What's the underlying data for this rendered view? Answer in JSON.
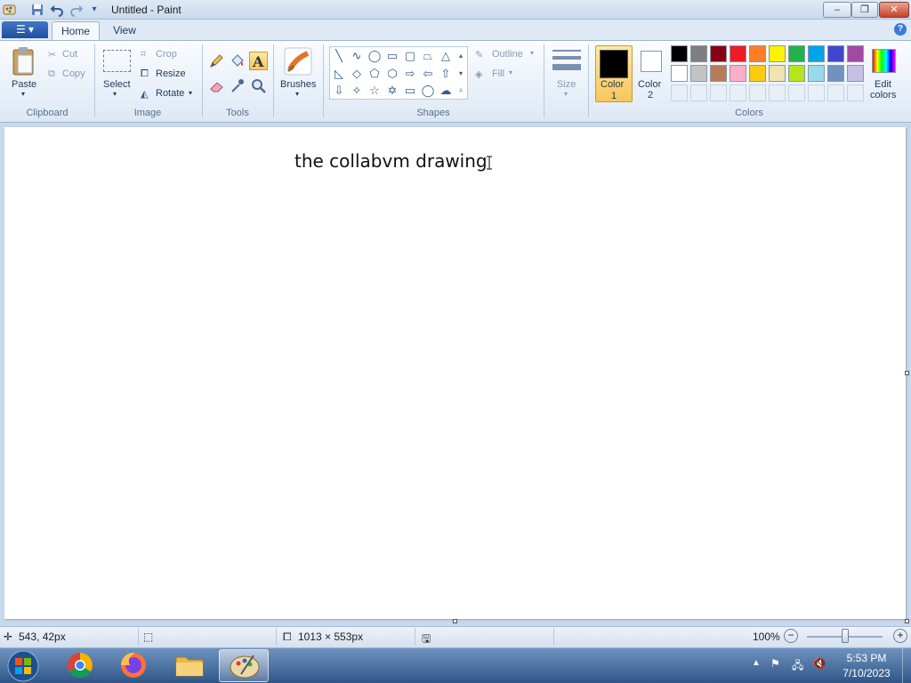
{
  "window": {
    "title": "Untitled - Paint",
    "minimize_label": "–",
    "restore_label": "❐",
    "close_label": "✕"
  },
  "quick_access": {
    "save_icon": "save-icon",
    "undo_icon": "undo-icon",
    "redo_icon": "redo-icon",
    "customize_icon": "dropdown-icon"
  },
  "tabs": [
    {
      "label": "Home",
      "active": true
    },
    {
      "label": "View",
      "active": false
    }
  ],
  "ribbon": {
    "clipboard": {
      "paste": "Paste",
      "cut": "Cut",
      "copy": "Copy",
      "group": "Clipboard"
    },
    "image": {
      "select": "Select",
      "crop": "Crop",
      "resize": "Resize",
      "rotate": "Rotate",
      "group": "Image"
    },
    "tools": {
      "group": "Tools",
      "items": [
        "pencil-icon",
        "fill-icon",
        "text-icon",
        "eraser-icon",
        "color-picker-icon",
        "magnifier-icon"
      ],
      "selected": "text-icon"
    },
    "brushes": {
      "label": "Brushes"
    },
    "shapes": {
      "outline": "Outline",
      "fill": "Fill",
      "group": "Shapes"
    },
    "size": {
      "label": "Size"
    },
    "colors": {
      "color1_line1": "Color",
      "color1_line2": "1",
      "color2_line1": "Color",
      "color2_line2": "2",
      "edit_line1": "Edit",
      "edit_line2": "colors",
      "group": "Colors",
      "color1": "#000000",
      "color2": "#ffffff",
      "palette_row1": [
        "#000000",
        "#7f7f7f",
        "#880015",
        "#ed1c24",
        "#ff7f27",
        "#fff200",
        "#22b14c",
        "#00a2e8",
        "#3f48cc",
        "#a349a4"
      ],
      "palette_row2": [
        "#ffffff",
        "#c3c3c3",
        "#b97a57",
        "#ffaec9",
        "#ffc90e",
        "#efe4b0",
        "#b5e61d",
        "#99d9ea",
        "#7092be",
        "#c8bfe7"
      ]
    }
  },
  "canvas": {
    "text": "the collabvm drawing"
  },
  "status": {
    "cursor_pos": "543, 42px",
    "canvas_size": "1013 × 553px",
    "zoom": "100%"
  },
  "taskbar": {
    "time": "5:53 PM",
    "date": "7/10/2023"
  }
}
